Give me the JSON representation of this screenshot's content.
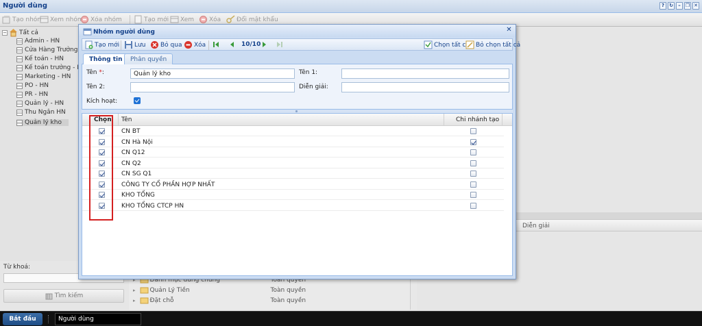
{
  "main_window": {
    "title": "Người dùng",
    "tools": [
      "?",
      "↻",
      "–",
      "❐",
      "✕"
    ]
  },
  "main_toolbar": {
    "new_group": "Tạo nhóm",
    "view_group": "Xem nhóm",
    "delete_group": "Xóa nhóm",
    "new": "Tạo mới",
    "view": "Xem",
    "delete": "Xóa",
    "change_password": "Đổi mật khẩu"
  },
  "tree": {
    "root": "Tất cả",
    "items": [
      "Admin - HN",
      "Cửa Hàng Trưởng - H",
      "Kế toán - HN",
      "Kế toán trưởng - HN",
      "Marketing - HN",
      "PO - HN",
      "PR - HN",
      "Quản lý - HN",
      "Thu Ngân HN",
      "Quản lý kho"
    ],
    "selected_index": 9
  },
  "search": {
    "keyword_label": "Từ khoá:",
    "keyword_value": "",
    "button": "Tìm kiếm"
  },
  "background": {
    "grid_header_label": "Diễn giải",
    "rows": [
      {
        "name": "Danh mục dùng chung",
        "right": "Toàn quyền"
      },
      {
        "name": "Quản Lý Tiền",
        "right": "Toàn quyền"
      },
      {
        "name": "Đặt chỗ",
        "right": "Toàn quyền"
      }
    ]
  },
  "taskbar": {
    "start": "Bắt đầu",
    "task": "Người dùng"
  },
  "dialog": {
    "title": "Nhóm người dùng",
    "toolbar": {
      "new": "Tạo mới",
      "save": "Lưu",
      "skip": "Bỏ qua",
      "delete": "Xóa",
      "pager": "10/10",
      "select_all": "Chọn tất cả",
      "deselect_all": "Bỏ chọn tất cả"
    },
    "tabs": [
      "Thông tin",
      "Phân quyền"
    ],
    "active_tab": 0,
    "form": {
      "name_label": "Tên",
      "required_mark": "*",
      "name_colon": ":",
      "name_value": "Quản lý kho",
      "name1_label": "Tên 1:",
      "name1_value": "",
      "name2_label": "Tên 2:",
      "name2_value": "",
      "desc_label": "Diễn giải:",
      "desc_value": "",
      "active_label": "Kích hoạt:",
      "active_checked": true
    },
    "grid": {
      "columns": [
        "Chọn",
        "Tên",
        "Chi nhánh tạo"
      ],
      "rows": [
        {
          "name": "CN BT",
          "selected": true,
          "created_branch": false
        },
        {
          "name": "CN Hà Nội",
          "selected": true,
          "created_branch": true
        },
        {
          "name": "CN Q12",
          "selected": true,
          "created_branch": false
        },
        {
          "name": "CN Q2",
          "selected": true,
          "created_branch": false
        },
        {
          "name": "CN SG Q1",
          "selected": true,
          "created_branch": false
        },
        {
          "name": "CÔNG TY CỔ PHẦN HỢP NHẤT",
          "selected": true,
          "created_branch": false
        },
        {
          "name": "KHO TỔNG",
          "selected": true,
          "created_branch": false
        },
        {
          "name": "KHO TỔNG CTCP HN",
          "selected": true,
          "created_branch": false
        }
      ]
    }
  },
  "colors": {
    "title_text": "#15428b",
    "highlight_border": "#d42020",
    "dialog_bg": "#cbdcf2"
  }
}
